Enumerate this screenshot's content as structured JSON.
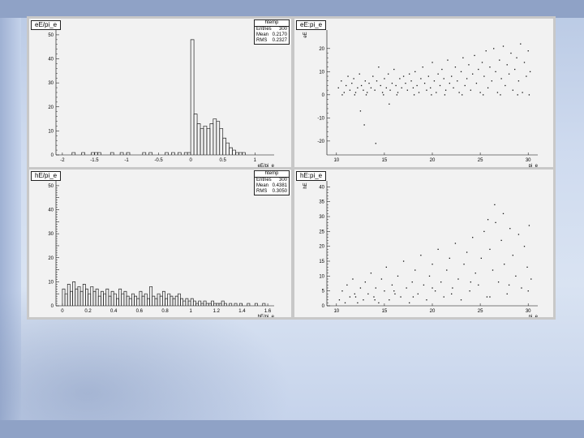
{
  "chart_data": [
    {
      "type": "histogram",
      "title": "eE/pi_e",
      "xlabel": "eE/pi_e",
      "ylabel": "",
      "xlim": [
        -2.1,
        1.3
      ],
      "ylim": [
        0,
        52
      ],
      "x_ticks": [
        -2,
        -1.5,
        -1,
        -0.5,
        0,
        0.5,
        1
      ],
      "x_tick_labels": [
        "-2",
        "-1.5",
        "-1",
        "-0.5",
        "0",
        "0.5",
        "1"
      ],
      "y_ticks": [
        0,
        10,
        20,
        30,
        40,
        50
      ],
      "stats": {
        "title": "htemp",
        "rows": [
          [
            "Entries",
            "300"
          ],
          [
            "Mean",
            "0.2170"
          ],
          [
            "RMS",
            "0.2327"
          ]
        ]
      },
      "bin_width": 0.05,
      "bins": [
        [
          -1.85,
          1
        ],
        [
          -1.7,
          1
        ],
        [
          -1.55,
          1
        ],
        [
          -1.5,
          1
        ],
        [
          -1.45,
          1
        ],
        [
          -1.25,
          1
        ],
        [
          -1.1,
          1
        ],
        [
          -1.0,
          1
        ],
        [
          -0.75,
          1
        ],
        [
          -0.65,
          1
        ],
        [
          -0.4,
          1
        ],
        [
          -0.3,
          1
        ],
        [
          -0.2,
          1
        ],
        [
          -0.1,
          1
        ],
        [
          -0.05,
          1
        ],
        [
          0.0,
          48
        ],
        [
          0.05,
          17
        ],
        [
          0.1,
          13
        ],
        [
          0.15,
          11
        ],
        [
          0.2,
          12
        ],
        [
          0.25,
          11
        ],
        [
          0.3,
          13
        ],
        [
          0.35,
          15
        ],
        [
          0.4,
          14
        ],
        [
          0.45,
          11
        ],
        [
          0.5,
          7
        ],
        [
          0.55,
          5
        ],
        [
          0.6,
          3
        ],
        [
          0.65,
          2
        ],
        [
          0.7,
          1
        ],
        [
          0.75,
          1
        ],
        [
          0.8,
          1
        ]
      ]
    },
    {
      "type": "scatter",
      "title": "eE:pi_e",
      "xlabel": "pi_e",
      "ylabel": "eE",
      "xlim": [
        9,
        31
      ],
      "ylim": [
        -26,
        28
      ],
      "x_ticks": [
        10,
        15,
        20,
        25,
        30
      ],
      "y_ticks": [
        -20,
        -10,
        0,
        10,
        20
      ],
      "points": [
        [
          10.2,
          3
        ],
        [
          10.5,
          6
        ],
        [
          10.8,
          1
        ],
        [
          11.0,
          4
        ],
        [
          11.2,
          8
        ],
        [
          11.4,
          2
        ],
        [
          11.6,
          5
        ],
        [
          11.8,
          7
        ],
        [
          12.0,
          1
        ],
        [
          12.2,
          3
        ],
        [
          12.4,
          9
        ],
        [
          12.6,
          4
        ],
        [
          12.8,
          2
        ],
        [
          13.0,
          6
        ],
        [
          13.2,
          1
        ],
        [
          13.4,
          5
        ],
        [
          13.6,
          3
        ],
        [
          13.8,
          8
        ],
        [
          14.0,
          2
        ],
        [
          14.2,
          6
        ],
        [
          14.4,
          12
        ],
        [
          14.6,
          4
        ],
        [
          14.8,
          1
        ],
        [
          15.0,
          7
        ],
        [
          15.2,
          3
        ],
        [
          15.4,
          9
        ],
        [
          15.6,
          2
        ],
        [
          15.8,
          5
        ],
        [
          16.0,
          11
        ],
        [
          16.2,
          4
        ],
        [
          16.4,
          1
        ],
        [
          16.6,
          7
        ],
        [
          16.8,
          3
        ],
        [
          17.0,
          8
        ],
        [
          17.2,
          5
        ],
        [
          17.4,
          2
        ],
        [
          17.6,
          9
        ],
        [
          17.8,
          6
        ],
        [
          18.0,
          3
        ],
        [
          18.2,
          10
        ],
        [
          18.4,
          4
        ],
        [
          18.6,
          1
        ],
        [
          18.8,
          7
        ],
        [
          19.0,
          12
        ],
        [
          19.2,
          5
        ],
        [
          19.4,
          2
        ],
        [
          19.6,
          8
        ],
        [
          19.8,
          3
        ],
        [
          20.0,
          14
        ],
        [
          20.2,
          6
        ],
        [
          20.4,
          1
        ],
        [
          20.6,
          9
        ],
        [
          20.8,
          4
        ],
        [
          21.0,
          11
        ],
        [
          21.2,
          7
        ],
        [
          21.4,
          2
        ],
        [
          21.6,
          15
        ],
        [
          21.8,
          5
        ],
        [
          22.0,
          8
        ],
        [
          22.2,
          3
        ],
        [
          22.4,
          12
        ],
        [
          22.6,
          6
        ],
        [
          22.8,
          1
        ],
        [
          23.0,
          10
        ],
        [
          23.2,
          16
        ],
        [
          23.4,
          4
        ],
        [
          23.6,
          7
        ],
        [
          23.8,
          13
        ],
        [
          24.0,
          2
        ],
        [
          24.2,
          9
        ],
        [
          24.4,
          17
        ],
        [
          24.6,
          5
        ],
        [
          24.8,
          11
        ],
        [
          25.0,
          1
        ],
        [
          25.2,
          14
        ],
        [
          25.4,
          8
        ],
        [
          25.6,
          19
        ],
        [
          25.8,
          3
        ],
        [
          26.0,
          12
        ],
        [
          26.2,
          6
        ],
        [
          26.4,
          20
        ],
        [
          26.6,
          10
        ],
        [
          26.8,
          1
        ],
        [
          27.0,
          15
        ],
        [
          27.2,
          7
        ],
        [
          27.4,
          21
        ],
        [
          27.6,
          4
        ],
        [
          27.8,
          13
        ],
        [
          28.0,
          9
        ],
        [
          28.2,
          18
        ],
        [
          28.4,
          2
        ],
        [
          28.6,
          11
        ],
        [
          28.8,
          16
        ],
        [
          29.0,
          6
        ],
        [
          29.2,
          22
        ],
        [
          29.4,
          1
        ],
        [
          29.6,
          14
        ],
        [
          29.8,
          8
        ],
        [
          30.0,
          19
        ],
        [
          30.2,
          10
        ],
        [
          10.6,
          0
        ],
        [
          11.9,
          0
        ],
        [
          13.1,
          0
        ],
        [
          14.9,
          0
        ],
        [
          16.3,
          0
        ],
        [
          18.1,
          0
        ],
        [
          19.9,
          0
        ],
        [
          21.3,
          0
        ],
        [
          23.1,
          0
        ],
        [
          25.3,
          0
        ],
        [
          27.1,
          0
        ],
        [
          28.9,
          0
        ],
        [
          30.1,
          0
        ],
        [
          12.5,
          -7
        ],
        [
          14.1,
          -21
        ],
        [
          15.5,
          -4
        ],
        [
          12.9,
          -13
        ]
      ]
    },
    {
      "type": "histogram",
      "title": "hE/pi_e",
      "xlabel": "hE/pi_e",
      "ylabel": "",
      "xlim": [
        -0.05,
        1.65
      ],
      "ylim": [
        0,
        52
      ],
      "x_ticks": [
        0,
        0.2,
        0.4,
        0.6,
        0.8,
        1,
        1.2,
        1.4,
        1.6
      ],
      "x_tick_labels": [
        "0",
        "0.2",
        "0.4",
        "0.6",
        "0.8",
        "1",
        "1.2",
        "1.4",
        "1.6"
      ],
      "y_ticks": [
        0,
        5,
        10,
        15,
        20,
        25,
        30,
        35,
        40,
        45,
        50
      ],
      "y_tick_labels": [
        "0",
        "",
        "10",
        "",
        "20",
        "",
        "30",
        "",
        "40",
        "",
        "50"
      ],
      "stats": {
        "title": "htemp",
        "rows": [
          [
            "Entries",
            "300"
          ],
          [
            "Mean",
            "0.4381"
          ],
          [
            "RMS",
            "0.3050"
          ]
        ]
      },
      "bin_width": 0.02,
      "bins": [
        [
          0.0,
          7
        ],
        [
          0.02,
          5
        ],
        [
          0.04,
          9
        ],
        [
          0.06,
          6
        ],
        [
          0.08,
          10
        ],
        [
          0.1,
          7
        ],
        [
          0.12,
          8
        ],
        [
          0.14,
          6
        ],
        [
          0.16,
          9
        ],
        [
          0.18,
          7
        ],
        [
          0.2,
          5
        ],
        [
          0.22,
          8
        ],
        [
          0.24,
          6
        ],
        [
          0.26,
          7
        ],
        [
          0.28,
          4
        ],
        [
          0.3,
          6
        ],
        [
          0.32,
          5
        ],
        [
          0.34,
          7
        ],
        [
          0.36,
          4
        ],
        [
          0.38,
          6
        ],
        [
          0.4,
          5
        ],
        [
          0.42,
          3
        ],
        [
          0.44,
          7
        ],
        [
          0.46,
          5
        ],
        [
          0.48,
          6
        ],
        [
          0.5,
          4
        ],
        [
          0.52,
          3
        ],
        [
          0.54,
          5
        ],
        [
          0.56,
          4
        ],
        [
          0.58,
          3
        ],
        [
          0.6,
          6
        ],
        [
          0.62,
          4
        ],
        [
          0.64,
          5
        ],
        [
          0.66,
          3
        ],
        [
          0.68,
          8
        ],
        [
          0.7,
          4
        ],
        [
          0.72,
          3
        ],
        [
          0.74,
          5
        ],
        [
          0.76,
          4
        ],
        [
          0.78,
          6
        ],
        [
          0.8,
          3
        ],
        [
          0.82,
          5
        ],
        [
          0.84,
          4
        ],
        [
          0.86,
          3
        ],
        [
          0.88,
          4
        ],
        [
          0.9,
          5
        ],
        [
          0.92,
          3
        ],
        [
          0.94,
          2
        ],
        [
          0.96,
          3
        ],
        [
          0.98,
          2
        ],
        [
          1.0,
          3
        ],
        [
          1.02,
          2
        ],
        [
          1.04,
          1
        ],
        [
          1.06,
          2
        ],
        [
          1.08,
          1
        ],
        [
          1.1,
          2
        ],
        [
          1.12,
          1
        ],
        [
          1.14,
          1
        ],
        [
          1.16,
          2
        ],
        [
          1.18,
          1
        ],
        [
          1.2,
          1
        ],
        [
          1.22,
          1
        ],
        [
          1.24,
          2
        ],
        [
          1.26,
          1
        ],
        [
          1.3,
          1
        ],
        [
          1.34,
          1
        ],
        [
          1.38,
          1
        ],
        [
          1.44,
          1
        ],
        [
          1.5,
          1
        ],
        [
          1.56,
          1
        ]
      ]
    },
    {
      "type": "scatter",
      "title": "hE:pi_e",
      "xlabel": "pi_e",
      "ylabel": "hE",
      "xlim": [
        9,
        31
      ],
      "ylim": [
        0,
        42
      ],
      "x_ticks": [
        10,
        15,
        20,
        25,
        30
      ],
      "y_ticks": [
        0,
        5,
        10,
        15,
        20,
        25,
        30,
        35,
        40
      ],
      "points": [
        [
          10.3,
          2
        ],
        [
          10.6,
          5
        ],
        [
          10.9,
          1
        ],
        [
          11.1,
          7
        ],
        [
          11.4,
          3
        ],
        [
          11.7,
          9
        ],
        [
          11.9,
          4
        ],
        [
          12.2,
          1
        ],
        [
          12.5,
          6
        ],
        [
          12.8,
          2
        ],
        [
          13.0,
          8
        ],
        [
          13.3,
          4
        ],
        [
          13.6,
          11
        ],
        [
          13.9,
          3
        ],
        [
          14.1,
          6
        ],
        [
          14.4,
          1
        ],
        [
          14.7,
          9
        ],
        [
          15.0,
          5
        ],
        [
          15.2,
          13
        ],
        [
          15.5,
          2
        ],
        [
          15.8,
          7
        ],
        [
          16.1,
          4
        ],
        [
          16.4,
          10
        ],
        [
          16.7,
          3
        ],
        [
          17.0,
          15
        ],
        [
          17.3,
          6
        ],
        [
          17.6,
          1
        ],
        [
          17.9,
          8
        ],
        [
          18.2,
          12
        ],
        [
          18.5,
          4
        ],
        [
          18.8,
          17
        ],
        [
          19.1,
          7
        ],
        [
          19.4,
          2
        ],
        [
          19.7,
          10
        ],
        [
          20.0,
          14
        ],
        [
          20.3,
          5
        ],
        [
          20.6,
          19
        ],
        [
          20.9,
          8
        ],
        [
          21.2,
          3
        ],
        [
          21.5,
          12
        ],
        [
          21.8,
          16
        ],
        [
          22.1,
          6
        ],
        [
          22.4,
          21
        ],
        [
          22.7,
          9
        ],
        [
          23.0,
          2
        ],
        [
          23.3,
          14
        ],
        [
          23.6,
          18
        ],
        [
          23.9,
          5
        ],
        [
          24.2,
          23
        ],
        [
          24.5,
          11
        ],
        [
          24.8,
          7
        ],
        [
          25.1,
          16
        ],
        [
          25.4,
          25
        ],
        [
          25.7,
          3
        ],
        [
          26.0,
          19
        ],
        [
          26.3,
          12
        ],
        [
          26.6,
          28
        ],
        [
          26.9,
          8
        ],
        [
          27.2,
          22
        ],
        [
          27.5,
          14
        ],
        [
          27.8,
          4
        ],
        [
          28.1,
          26
        ],
        [
          28.4,
          17
        ],
        [
          28.7,
          10
        ],
        [
          29.0,
          24
        ],
        [
          29.3,
          6
        ],
        [
          29.6,
          20
        ],
        [
          29.9,
          13
        ],
        [
          30.1,
          27
        ],
        [
          30.3,
          9
        ],
        [
          12.0,
          3
        ],
        [
          14.0,
          2
        ],
        [
          16.0,
          5
        ],
        [
          18.0,
          3
        ],
        [
          20.0,
          6
        ],
        [
          22.0,
          4
        ],
        [
          24.0,
          8
        ],
        [
          26.0,
          3
        ],
        [
          28.0,
          7
        ],
        [
          30.0,
          5
        ],
        [
          26.5,
          34
        ],
        [
          27.4,
          31
        ],
        [
          25.8,
          29
        ]
      ]
    }
  ]
}
